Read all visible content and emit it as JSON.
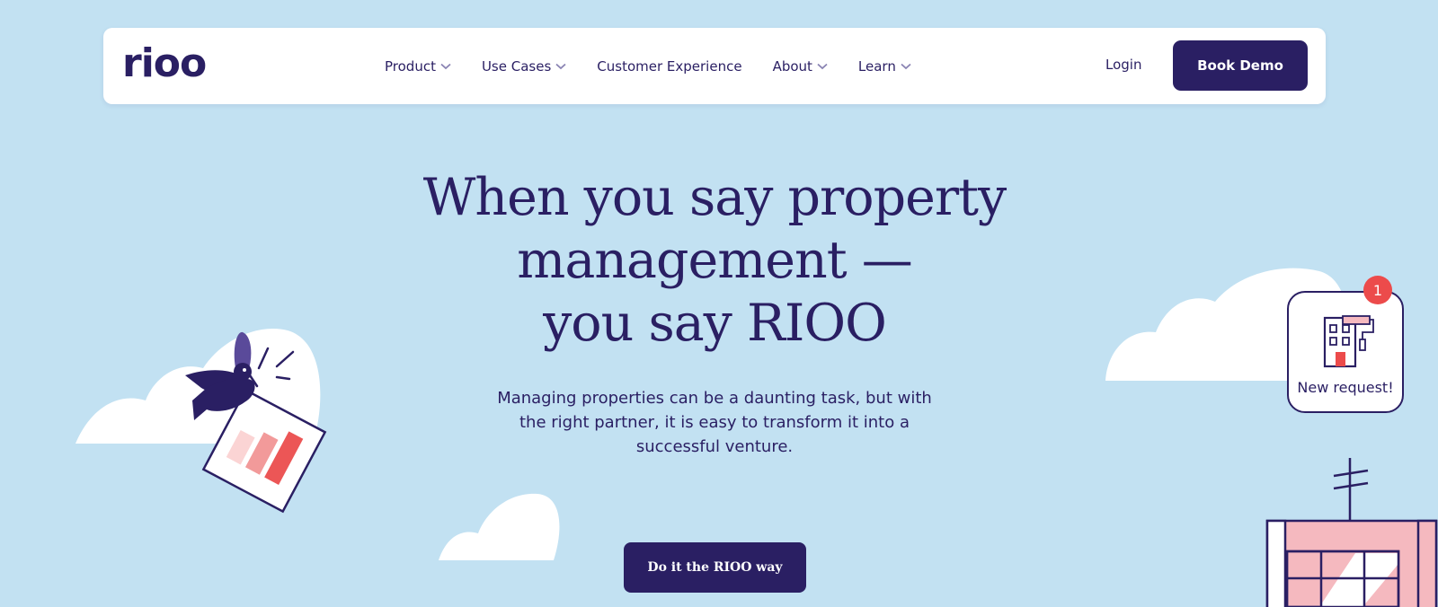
{
  "brand": {
    "logo_text": "rioo"
  },
  "nav": {
    "items": [
      {
        "label": "Product",
        "has_dropdown": true
      },
      {
        "label": "Use Cases",
        "has_dropdown": true
      },
      {
        "label": "Customer Experience",
        "has_dropdown": false
      },
      {
        "label": "About",
        "has_dropdown": true
      },
      {
        "label": "Learn",
        "has_dropdown": true
      }
    ],
    "login_label": "Login",
    "demo_label": "Book Demo"
  },
  "hero": {
    "title_lines": [
      "When you say property",
      "management —",
      "you say RIOO"
    ],
    "subtitle_lines": [
      "Managing properties can be a daunting task, but with",
      "the right partner, it is easy to transform it into a",
      "successful venture."
    ],
    "cta_label": "Do it the RIOO way"
  },
  "notification": {
    "label": "New request!",
    "badge_count": "1"
  },
  "colors": {
    "background": "#c2e1f2",
    "primary": "#2a1f63",
    "white": "#ffffff",
    "badge": "#ec4b4b",
    "bar_light": "#fbd4d4",
    "bar_mid": "#f29a9a",
    "bar_dark": "#ec5656",
    "bird_wing": "#5a4a9a",
    "building_pink": "#f5b9bf"
  }
}
